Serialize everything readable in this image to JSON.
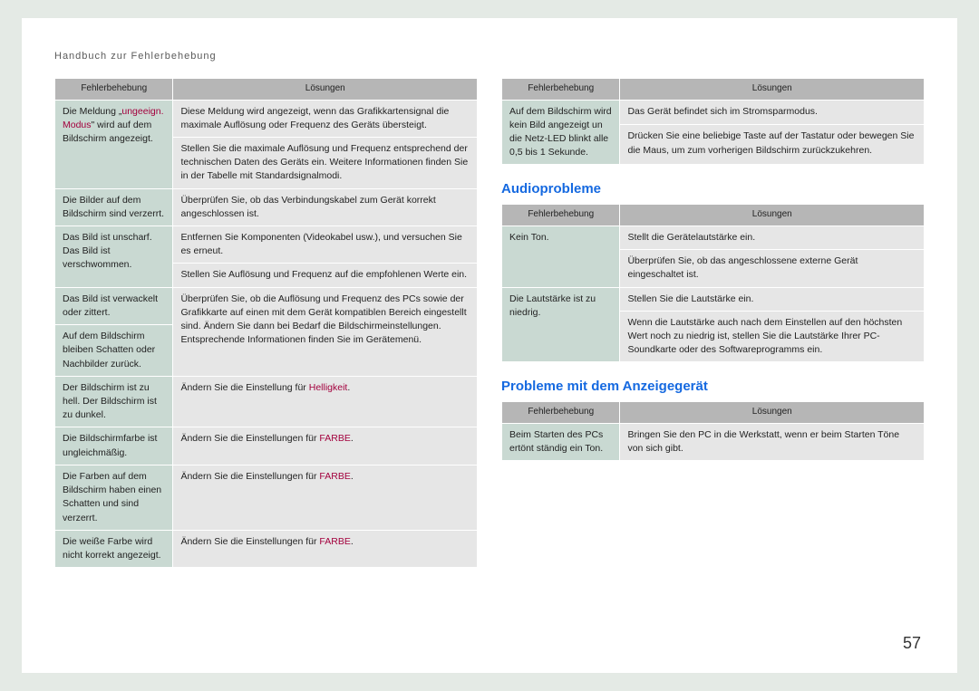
{
  "header": "Handbuch zur Fehlerbehebung",
  "page_number": "57",
  "table_headers": {
    "problem": "Fehlerbehebung",
    "solution": "Lösungen"
  },
  "section_audio": "Audioprobleme",
  "section_display": "Probleme mit dem Anzeigegerät",
  "hl": {
    "ungeeign": "ungeeign. Modus",
    "helligkeit": "Helligkeit",
    "farbe": "FARBE"
  },
  "left_table": [
    {
      "problem_pre": "Die Meldung „",
      "problem_post": "\" wird auf dem Bildschirm angezeigt.",
      "problem_hl_key": "ungeeign",
      "solutions": [
        "Diese Meldung wird angezeigt, wenn das Grafikkartensignal die maximale Auflösung oder Frequenz des Geräts übersteigt.",
        "Stellen Sie die maximale Auflösung und Frequenz entsprechend der technischen Daten des Geräts ein. Weitere Informationen finden Sie in der Tabelle mit Standardsignalmodi."
      ]
    },
    {
      "problem": "Die Bilder auf dem Bildschirm sind verzerrt.",
      "solutions": [
        "Überprüfen Sie, ob das Verbindungskabel zum Gerät korrekt angeschlossen ist."
      ]
    },
    {
      "problem": "Das Bild ist unscharf. Das Bild ist verschwommen.",
      "solutions": [
        "Entfernen Sie Komponenten (Videokabel usw.), und versuchen Sie es erneut.",
        "Stellen Sie Auflösung und Frequenz auf die empfohlenen Werte ein."
      ]
    },
    {
      "problems": [
        "Das Bild ist verwackelt oder zittert.",
        "Auf dem Bildschirm bleiben Schatten oder Nachbilder zurück."
      ],
      "solutions": [
        "Überprüfen Sie, ob die Auflösung und Frequenz des PCs sowie der Grafikkarte auf einen mit dem Gerät kompatiblen Bereich eingestellt sind. Ändern Sie dann bei Bedarf die Bildschirmeinstellungen. Entsprechende Informationen finden Sie im Gerätemenü."
      ]
    },
    {
      "problem": "Der Bildschirm ist zu hell. Der Bildschirm ist zu dunkel.",
      "solution_pre": "Ändern Sie die Einstellung für ",
      "solution_hl_key": "helligkeit",
      "solution_post": "."
    },
    {
      "problem": "Die Bildschirmfarbe ist ungleichmäßig.",
      "solution_pre": "Ändern Sie die Einstellungen für ",
      "solution_hl_key": "farbe",
      "solution_post": "."
    },
    {
      "problem": "Die Farben auf dem Bildschirm haben einen Schatten und sind verzerrt.",
      "solution_pre": "Ändern Sie die Einstellungen für ",
      "solution_hl_key": "farbe",
      "solution_post": "."
    },
    {
      "problem": "Die weiße Farbe wird nicht korrekt angezeigt.",
      "solution_pre": "Ändern Sie die Einstellungen für ",
      "solution_hl_key": "farbe",
      "solution_post": "."
    }
  ],
  "right_top_table": [
    {
      "problem": "Auf dem Bildschirm wird kein Bild angezeigt un die Netz-LED blinkt alle 0,5 bis 1 Sekunde.",
      "solutions": [
        "Das Gerät befindet sich im Stromsparmodus.",
        "Drücken Sie eine beliebige Taste auf der Tastatur oder bewegen Sie die Maus, um zum vorherigen Bildschirm zurückzukehren."
      ]
    }
  ],
  "audio_table": [
    {
      "problem": "Kein Ton.",
      "solutions": [
        "Stellt die Gerätelautstärke ein.",
        "Überprüfen Sie, ob das angeschlossene externe Gerät eingeschaltet ist."
      ]
    },
    {
      "problem": "Die Lautstärke ist zu niedrig.",
      "solutions": [
        "Stellen Sie die Lautstärke ein.",
        "Wenn die Lautstärke auch nach dem Einstellen auf den höchsten Wert noch zu niedrig ist, stellen Sie die Lautstärke Ihrer PC-Soundkarte oder des Softwareprogramms ein."
      ]
    }
  ],
  "display_table": [
    {
      "problem": "Beim Starten des PCs ertönt ständig ein Ton.",
      "solutions": [
        "Bringen Sie den PC in die Werkstatt, wenn er beim Starten Töne von sich gibt."
      ]
    }
  ]
}
